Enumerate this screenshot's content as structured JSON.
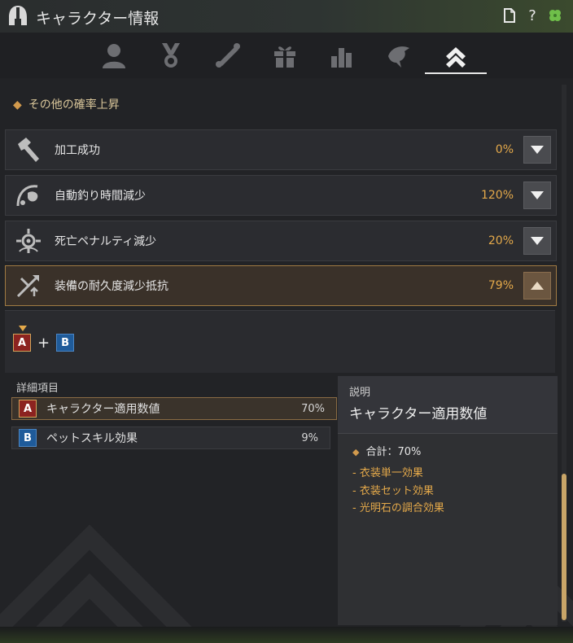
{
  "window": {
    "title": "キャラクター情報",
    "icons": [
      "document-icon",
      "help-icon",
      "clover-icon"
    ],
    "help_glyph": "?"
  },
  "tabs": [
    {
      "name": "profile-icon",
      "active": false
    },
    {
      "name": "medal-icon",
      "active": false
    },
    {
      "name": "scroll-icon",
      "active": false
    },
    {
      "name": "gift-icon",
      "active": false
    },
    {
      "name": "bar-chart-icon",
      "active": false
    },
    {
      "name": "dragon-icon",
      "active": false
    },
    {
      "name": "chevron-up-double-icon",
      "active": true
    }
  ],
  "section": {
    "title": "その他の確率上昇"
  },
  "rows": [
    {
      "label": "加工成功",
      "value": "0%",
      "icon": "hammer-icon",
      "expanded": false
    },
    {
      "label": "自動釣り時間減少",
      "value": "120%",
      "icon": "fishing-icon",
      "expanded": false
    },
    {
      "label": "死亡ペナルティ減少",
      "value": "20%",
      "icon": "penalty-icon",
      "expanded": false
    },
    {
      "label": "装備の耐久度減少抵抗",
      "value": "79%",
      "icon": "durability-icon",
      "expanded": true
    }
  ],
  "formula": {
    "a": "A",
    "plus": "+",
    "b": "B"
  },
  "details": {
    "title": "詳細項目",
    "items": [
      {
        "badge": "A",
        "label": "キャラクター適用数値",
        "value": "70%",
        "selected": true
      },
      {
        "badge": "B",
        "label": "ペットスキル効果",
        "value": "9%",
        "selected": false
      }
    ]
  },
  "description": {
    "label": "説明",
    "title": "キャラクター適用数値",
    "total": "合計：70%",
    "items": [
      "-  衣装単一効果",
      "-  衣装セット効果",
      "-  光明石の調合効果"
    ]
  },
  "colors": {
    "accent": "#e4a94a",
    "badge_a": "#8c2320",
    "badge_b": "#1f5b9a"
  }
}
